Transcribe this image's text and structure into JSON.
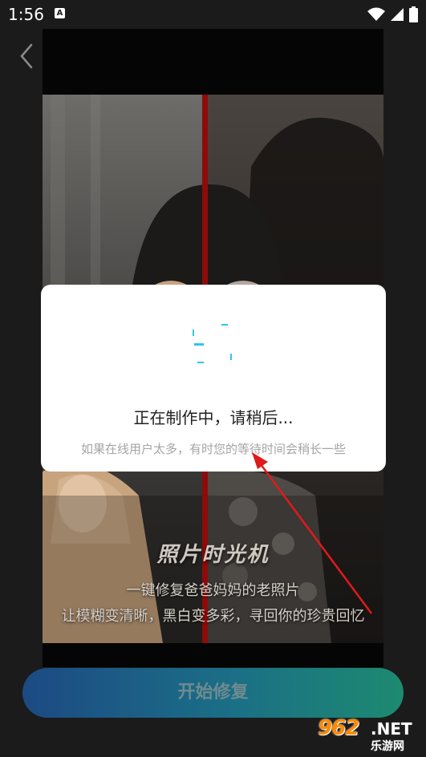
{
  "status_bar": {
    "time": "1:56",
    "notification_icon_label": "A"
  },
  "preview": {
    "title": "照片时光机",
    "line1": "一键修复爸爸妈妈的老照片",
    "line2": "让模糊变清晰，黑白变多彩，寻回你的珍贵回忆"
  },
  "dialog": {
    "title": "正在制作中，请稍后...",
    "subtitle": "如果在线用户太多，有时您的等待时间会稍长一些"
  },
  "start_button": {
    "label": "开始修复"
  },
  "watermark": {
    "number": "962",
    "net": ".NET",
    "cn": "乐游网"
  },
  "colors": {
    "accent": "#8d0b0b",
    "spinner": "#2ec7e6",
    "arrow": "#e01a1a"
  }
}
